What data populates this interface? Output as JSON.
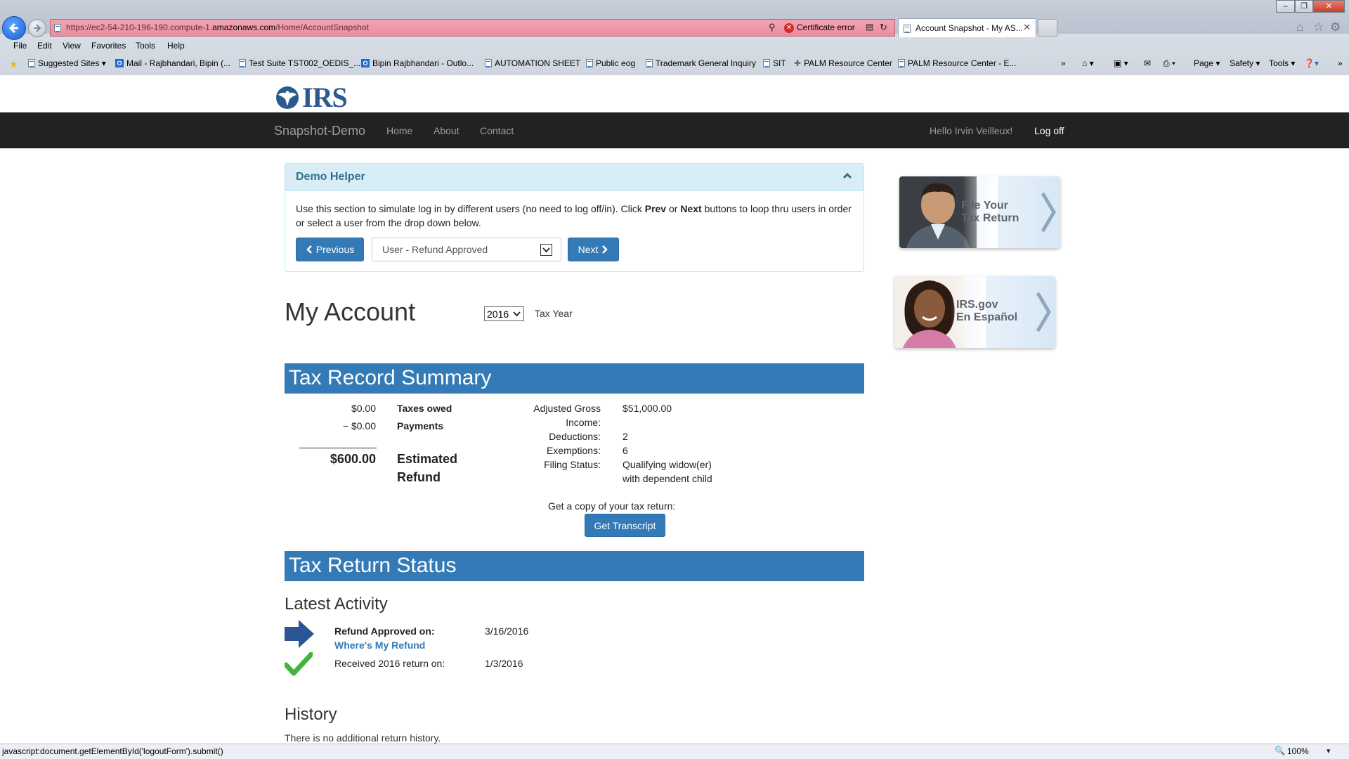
{
  "browser": {
    "url_prefix": "https://ec2-54-210-196-190.compute-1.",
    "url_host": "amazonaws.com",
    "url_path": "/Home/AccountSnapshot",
    "cert_error": "Certificate error",
    "tab_title": "Account Snapshot - My AS...",
    "menu": [
      "File",
      "Edit",
      "View",
      "Favorites",
      "Tools",
      "Help"
    ],
    "favorites": [
      "Suggested Sites ▾",
      "Mail - Rajbhandari, Bipin (...",
      "Test Suite TST002_OEDIS_...",
      "Bipin Rajbhandari - Outlo...",
      "AUTOMATION SHEET",
      "Public eog",
      "Trademark General Inquiry",
      "SIT",
      "PALM Resource Center",
      "PALM Resource Center - E..."
    ],
    "tools": [
      "Page ▾",
      "Safety ▾",
      "Tools ▾"
    ],
    "status_text": "javascript:document.getElementById('logoutForm').submit()",
    "zoom": "100%"
  },
  "site": {
    "logo_text": "IRS",
    "brand": "Snapshot-Demo",
    "nav": [
      "Home",
      "About",
      "Contact"
    ],
    "greeting": "Hello Irvin Veilleux!",
    "logoff": "Log off"
  },
  "helper": {
    "title": "Demo Helper",
    "text_parts": [
      "Use this section to simulate log in by different users (no need to log off/in). Click ",
      "Prev",
      " or ",
      "Next",
      " buttons to loop thru users in order or select a user from the drop down below."
    ],
    "previous_label": "Previous",
    "next_label": "Next",
    "user_selected": "User - Refund Approved"
  },
  "account": {
    "title": "My Account",
    "year": "2016",
    "year_label": "Tax Year"
  },
  "summary": {
    "title": "Tax Record Summary",
    "taxes_owed_amount": "$0.00",
    "taxes_owed_label": "Taxes owed",
    "payments_amount": "− $0.00",
    "payments_label": "Payments",
    "refund_amount": "$600.00",
    "refund_label_1": "Estimated",
    "refund_label_2": "Refund",
    "agi_label_1": "Adjusted Gross",
    "agi_label_2": "Income:",
    "agi_value": "$51,000.00",
    "deductions_label": "Deductions:",
    "deductions_value": "2",
    "exemptions_label": "Exemptions:",
    "exemptions_value": "6",
    "filing_label": "Filing Status:",
    "filing_value_1": "Qualifying widow(er)",
    "filing_value_2": "with dependent child",
    "copy_prompt": "Get a copy of your tax return:",
    "transcript_button": "Get Transcript"
  },
  "status": {
    "title": "Tax Return Status",
    "latest_heading": "Latest Activity",
    "approved_label": "Refund Approved on:",
    "approved_date": "3/16/2016",
    "wmr_link": "Where's My Refund",
    "received_label": "Received 2016 return on:",
    "received_date": "1/3/2016",
    "history_heading": "History",
    "history_text": "There is no additional return history."
  },
  "ads": {
    "file_line1": "File Your",
    "file_line2": "Tax Return",
    "esp_line1": "IRS.gov",
    "esp_line2": "En Español"
  }
}
